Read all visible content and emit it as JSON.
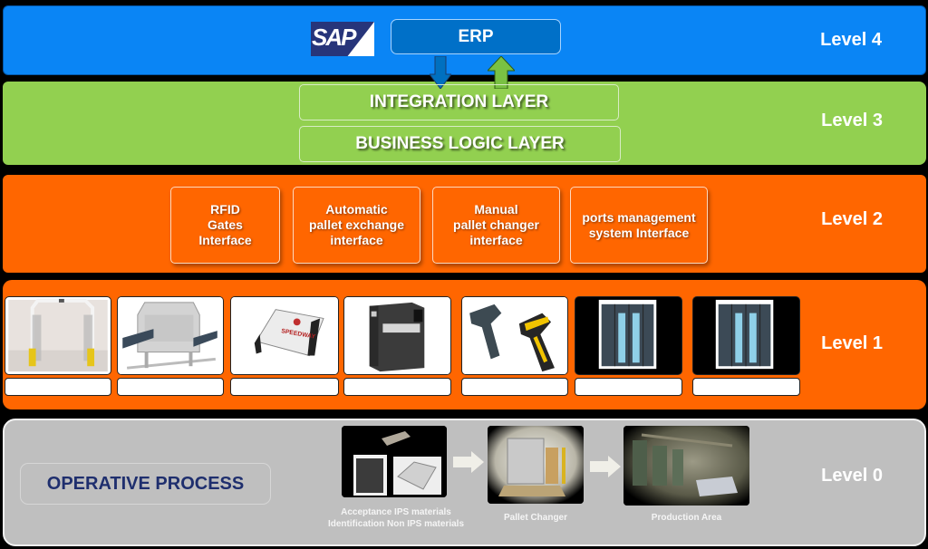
{
  "levels": {
    "l4": "Level 4",
    "l3": "Level 3",
    "l2": "Level 2",
    "l1": "Level 1",
    "l0": "Level 0"
  },
  "level4": {
    "logo_text": "SAP",
    "erp_label": "ERP",
    "arrows": [
      "down-arrow-blue",
      "up-arrow-green"
    ]
  },
  "level3": {
    "layers": [
      "INTEGRATION LAYER",
      "BUSINESS LOGIC LAYER"
    ]
  },
  "level2": {
    "interfaces": [
      "RFID\nGates\nInterface",
      "Automatic\npallet exchange\ninterface",
      "Manual\npallet changer\ninterface",
      "ports management\nsystem Interface"
    ]
  },
  "level1": {
    "devices": [
      {
        "icon": "rfid-gate-icon",
        "caption": ""
      },
      {
        "icon": "pallet-exchanger-machine-icon",
        "caption": ""
      },
      {
        "icon": "rfid-reader-icon",
        "caption": ""
      },
      {
        "icon": "label-printer-icon",
        "caption": ""
      },
      {
        "icon": "barcode-scanners-icon",
        "caption": ""
      },
      {
        "icon": "plc-controller-icon",
        "caption": ""
      },
      {
        "icon": "plc-controller-icon",
        "caption": ""
      }
    ]
  },
  "level0": {
    "title": "OPERATIVE PROCESS",
    "steps": [
      {
        "icon": "acceptance-devices-photo",
        "caption": "Acceptance IPS materials\nIdentification Non IPS materials"
      },
      {
        "icon": "pallet-changer-photo",
        "caption": "Pallet Changer"
      },
      {
        "icon": "production-area-photo",
        "caption": "Production Area"
      }
    ]
  },
  "colors": {
    "level4": "#0a85f5",
    "level3": "#92d050",
    "level2": "#ff6600",
    "level1": "#ff6600",
    "level0": "#bfbfbf",
    "operative_text": "#1f2f6e"
  }
}
